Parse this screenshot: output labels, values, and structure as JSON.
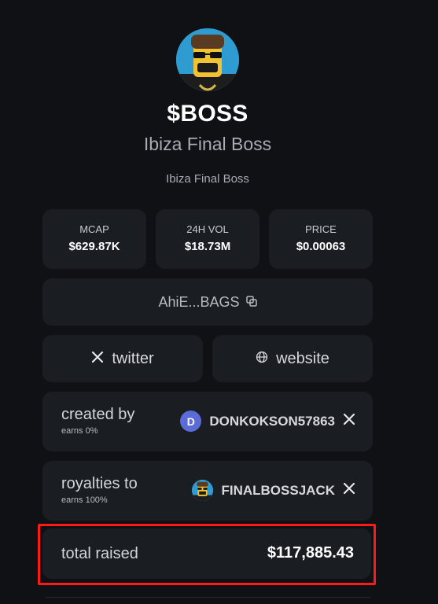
{
  "token": {
    "symbol": "$BOSS",
    "name": "Ibiza Final Boss",
    "description": "Ibiza Final Boss"
  },
  "stats": [
    {
      "label": "MCAP",
      "value": "$629.87K"
    },
    {
      "label": "24H VOL",
      "value": "$18.73M"
    },
    {
      "label": "PRICE",
      "value": "$0.00063"
    }
  ],
  "contract": {
    "short": "AhiE...BAGS"
  },
  "links": {
    "twitter_label": "twitter",
    "website_label": "website"
  },
  "creator": {
    "label": "created by",
    "earns": "earns 0%",
    "avatar_letter": "D",
    "username": "DONKOKSON57863"
  },
  "royalties": {
    "label": "royalties to",
    "earns": "earns 100%",
    "username": "FINALBOSSJACK"
  },
  "raised": {
    "label": "total raised",
    "value": "$117,885.43"
  },
  "colors": {
    "background": "#0f1115",
    "card": "#1a1d22",
    "highlight": "#ff1a1a",
    "creator_avatar": "#5b6cd8"
  }
}
